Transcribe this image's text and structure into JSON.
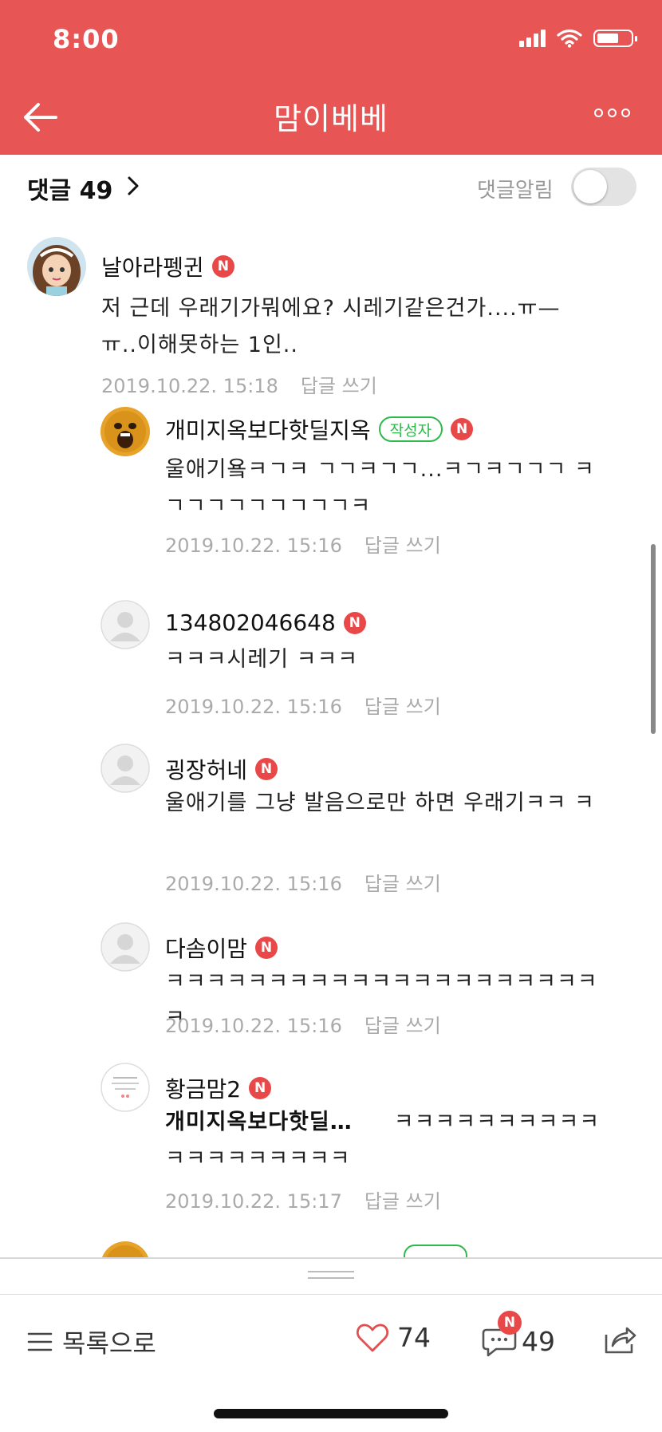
{
  "status_bar": {
    "time": "8:00"
  },
  "header": {
    "title": "맘이베베"
  },
  "comment_bar": {
    "label": "댓글 49",
    "alert_label": "댓글알림"
  },
  "comments": [
    {
      "user": "날아라펭귄",
      "text": "저 근데 우래기가뭐에요? 시레기같은건가....ㅠ— ㅠ..이해못하는 1인..",
      "time": "2019.10.22. 15:18",
      "reply": "답글 쓰기"
    },
    {
      "user": "개미지옥보다핫딜지옥",
      "author_tag": "작성자",
      "text": "울애기욬ㅋㄱㅋ ㄱㄱㅋㄱㄱ...ㅋㄱㅋㄱㄱㄱ ㅋㄱㄱㄱㄱㄱㄱㄱㄱㄱㅋ",
      "time": "2019.10.22. 15:16",
      "reply": "답글 쓰기"
    },
    {
      "user": "134802046648",
      "text": "ㅋㅋㅋ시레기 ㅋㅋㅋ",
      "time": "2019.10.22. 15:16",
      "reply": "답글 쓰기"
    },
    {
      "user": "굉장허네",
      "text": "울애기를 그냥 발음으로만 하면 우래기ㅋㅋ ㅋ",
      "time": "2019.10.22. 15:16",
      "reply": "답글 쓰기"
    },
    {
      "user": "다솜이맘",
      "text": "ㅋㅋㅋㅋㅋㅋㅋㅋㅋㅋㅋㅋㅋㅋㅋㅋㅋㅋㅋㅋㅋㅋ",
      "time": "2019.10.22. 15:16",
      "reply": "답글 쓰기"
    },
    {
      "user": "황금맘2",
      "mention": "개미지옥보다핫딜…",
      "text": "ㅋㅋㅋㅋㅋㅋㅋㅋㅋㅋ ㅋㅋㅋㅋㅋㅋㅋㅋㅋ",
      "time": "2019.10.22. 15:17",
      "reply": "답글 쓰기"
    }
  ],
  "badge_new": "N",
  "bottom_bar": {
    "list_label": "목록으로",
    "like_count": "74",
    "comment_count": "49"
  },
  "colors": {
    "brand": "#e85555",
    "author_green": "#2eb84b",
    "badge_red": "#e84848"
  }
}
